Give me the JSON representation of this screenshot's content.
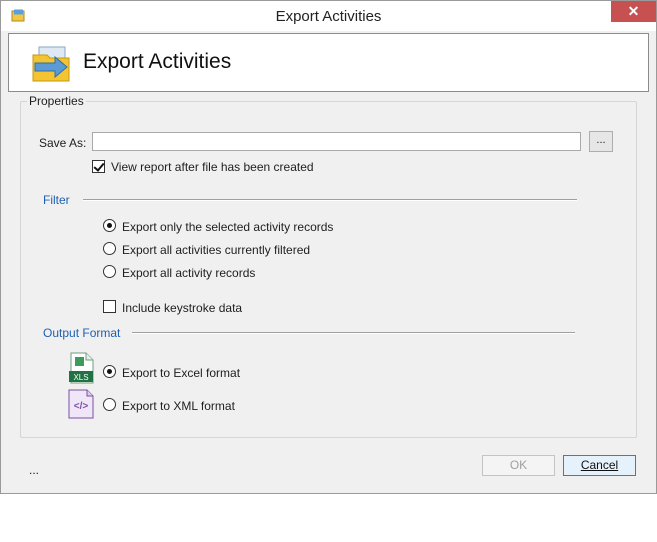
{
  "window": {
    "title": "Export Activities",
    "close_symbol": "✕"
  },
  "header": {
    "title": "Export Activities"
  },
  "properties": {
    "legend": "Properties",
    "save_as_label": "Save As:",
    "save_as_value": "",
    "browse_label": "...",
    "view_report_label": "View report after file has been created",
    "view_report_checked": true
  },
  "filter": {
    "title": "Filter",
    "options": [
      {
        "label": "Export only the selected activity records",
        "selected": true
      },
      {
        "label": "Export all activities currently filtered",
        "selected": false
      },
      {
        "label": "Export all activity records",
        "selected": false
      }
    ],
    "keystroke_label": "Include keystroke data",
    "keystroke_checked": false
  },
  "output_format": {
    "title": "Output Format",
    "options": [
      {
        "label": "Export to Excel format",
        "selected": true,
        "icon": "excel-file-icon",
        "icon_text": "XLS"
      },
      {
        "label": "Export to XML format",
        "selected": false,
        "icon": "xml-file-icon",
        "icon_text": "</>"
      }
    ]
  },
  "buttons": {
    "ok": "OK",
    "cancel": "Cancel"
  },
  "status_text": "...",
  "colors": {
    "accent_blue": "#1f5fb0",
    "close_red": "#c75050",
    "excel_green": "#207245",
    "xml_purple": "#7b4fa6"
  }
}
